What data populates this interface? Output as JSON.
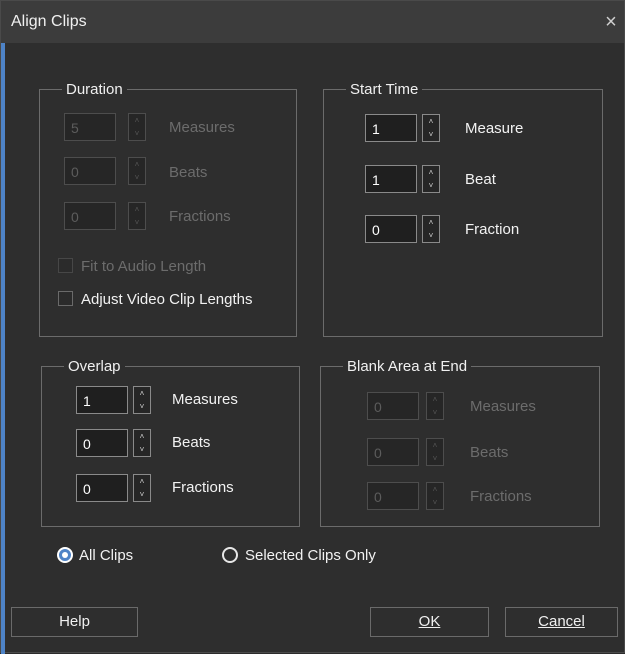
{
  "window": {
    "title": "Align Clips",
    "close_glyph": "×"
  },
  "duration": {
    "legend": "Duration",
    "measures": {
      "value": "5",
      "label": "Measures"
    },
    "beats": {
      "value": "0",
      "label": "Beats"
    },
    "fractions": {
      "value": "0",
      "label": "Fractions"
    },
    "fit_audio": "Fit to Audio Length",
    "adjust_video": "Adjust Video Clip Lengths"
  },
  "start_time": {
    "legend": "Start Time",
    "measure": {
      "value": "1",
      "label": "Measure"
    },
    "beat": {
      "value": "1",
      "label": "Beat"
    },
    "fraction": {
      "value": "0",
      "label": "Fraction"
    }
  },
  "overlap": {
    "legend": "Overlap",
    "measures": {
      "value": "1",
      "label": "Measures"
    },
    "beats": {
      "value": "0",
      "label": "Beats"
    },
    "fractions": {
      "value": "0",
      "label": "Fractions"
    }
  },
  "blank_area": {
    "legend": "Blank Area at End",
    "measures": {
      "value": "0",
      "label": "Measures"
    },
    "beats": {
      "value": "0",
      "label": "Beats"
    },
    "fractions": {
      "value": "0",
      "label": "Fractions"
    }
  },
  "scope": {
    "all_clips": "All Clips",
    "selected_only": "Selected Clips Only",
    "selected": "all_clips"
  },
  "buttons": {
    "help": "Help",
    "ok": "OK",
    "cancel": "Cancel"
  },
  "icons": {
    "spin_up": "˄",
    "spin_down": "˅"
  },
  "colors": {
    "accent": "#4e83c7",
    "background": "#2e2e2e",
    "disabled_text": "#6e6e6e"
  }
}
